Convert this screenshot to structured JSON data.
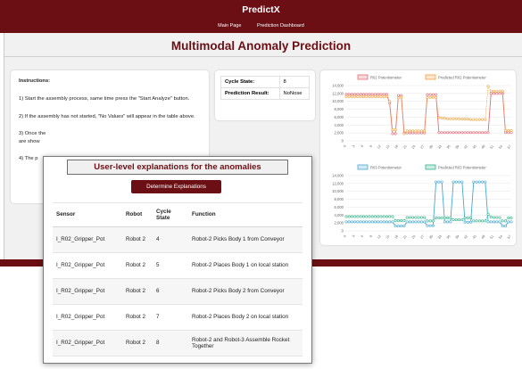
{
  "app": {
    "brand": "PredictX",
    "nav": [
      "Main Page",
      "Prediction Dashboard"
    ]
  },
  "page_title": "Multimodal Anomaly Prediction",
  "instructions": {
    "heading": "Instructions:",
    "items": [
      "1) Start the assembly process, same time press the \"Start Analyze\" button.",
      "2) If the assembly has not started, \"No Values\" will appear in the table above.",
      "3) Once the",
      "are show",
      "4) The p"
    ]
  },
  "state": {
    "cycle_label": "Cycle State:",
    "cycle_value": "8",
    "prediction_label": "Prediction Result:",
    "prediction_value": "NoNose"
  },
  "explanations": {
    "title": "User-level explanations for the anomalies",
    "button": "Determine Explanations",
    "headers": [
      "Sensor",
      "Robot",
      "Cycle State",
      "Function"
    ],
    "rows": [
      [
        "I_R02_Gripper_Pot",
        "Robot 2",
        "4",
        "Robot-2 Picks Body 1 from Conveyor"
      ],
      [
        "I_R02_Gripper_Pot",
        "Robot 2",
        "5",
        "Robot-2 Places Body 1 on local station"
      ],
      [
        "I_R02_Gripper_Pot",
        "Robot 2",
        "6",
        "Robot-2 Picks Body 2 from Conveyor"
      ],
      [
        "I_R02_Gripper_Pot",
        "Robot 2",
        "7",
        "Robot-2 Places Body 2 on local station"
      ],
      [
        "I_R02_Gripper_Pot",
        "Robot 2",
        "8",
        "Robot-2 and Robot-3 Assemble Rocket Together"
      ]
    ]
  },
  "colors": {
    "brand": "#6b0f14",
    "r02": "#e46b78",
    "r02_pred": "#f2a13a",
    "r03": "#46a8d6",
    "r03_pred": "#2fb38a"
  },
  "chart_data": [
    {
      "type": "line",
      "legend": [
        "R02 Potentiometer",
        "Predicted R02 Potentiometer"
      ],
      "legend_position": "top",
      "ylim": [
        0,
        14000
      ],
      "yticks": [
        "14,000",
        "12,000",
        "10,000",
        "8,000",
        "6,000",
        "4,000",
        "2,000",
        "0"
      ],
      "x": [
        0,
        1,
        2,
        3,
        4,
        5,
        6,
        7,
        8,
        9,
        10,
        11,
        12,
        13,
        14,
        15,
        16,
        17,
        18,
        19,
        20,
        21,
        22,
        23,
        24,
        25,
        26,
        27,
        28,
        29,
        30,
        31,
        32,
        33,
        34,
        35,
        36,
        37,
        38,
        39,
        40,
        41,
        42,
        43,
        44,
        45,
        46,
        47,
        48,
        49,
        50,
        51,
        52,
        53,
        54,
        55,
        56,
        57
      ],
      "xticks": [
        "0",
        "3",
        "6",
        "9",
        "12",
        "15",
        "18",
        "21",
        "24",
        "27",
        "30",
        "33",
        "36",
        "39",
        "42",
        "45",
        "48",
        "51",
        "54",
        "57"
      ],
      "series": [
        {
          "name": "R02 Potentiometer",
          "values": [
            11800,
            11800,
            11800,
            11800,
            11800,
            11800,
            11800,
            11800,
            11800,
            11800,
            11800,
            11800,
            11800,
            11800,
            11800,
            9500,
            1800,
            1800,
            11500,
            11500,
            2000,
            2000,
            2000,
            2000,
            2000,
            2000,
            2000,
            2000,
            11700,
            11700,
            11700,
            11700,
            2100,
            2100,
            2100,
            2100,
            2100,
            2100,
            2100,
            2100,
            2100,
            2100,
            2100,
            2100,
            2100,
            2100,
            2100,
            2100,
            2100,
            2100,
            12000,
            12000,
            12000,
            12000,
            12000,
            2100,
            2100,
            2100
          ]
        },
        {
          "name": "Predicted R02 Potentiometer",
          "values": [
            11200,
            11200,
            11200,
            11200,
            11200,
            11200,
            11200,
            11200,
            11200,
            11200,
            11200,
            11200,
            11200,
            11200,
            11200,
            10000,
            2800,
            2800,
            10900,
            11000,
            1800,
            2500,
            2500,
            2500,
            2500,
            2500,
            2500,
            2500,
            11000,
            11000,
            11000,
            11000,
            5900,
            5800,
            5700,
            5600,
            5600,
            5600,
            5600,
            5600,
            5500,
            5500,
            5500,
            5400,
            5400,
            5400,
            5400,
            5400,
            5400,
            13800,
            12600,
            12600,
            12600,
            12600,
            12600,
            2600,
            2600,
            2600
          ]
        }
      ]
    },
    {
      "type": "line",
      "legend": [
        "R03 Potentiometer",
        "Predicted R03 Potentiometer"
      ],
      "legend_position": "top",
      "ylim": [
        0,
        14000
      ],
      "yticks": [
        "14,000",
        "12,000",
        "10,000",
        "8,000",
        "6,000",
        "4,000",
        "2,000",
        "0"
      ],
      "x": [
        0,
        1,
        2,
        3,
        4,
        5,
        6,
        7,
        8,
        9,
        10,
        11,
        12,
        13,
        14,
        15,
        16,
        17,
        18,
        19,
        20,
        21,
        22,
        23,
        24,
        25,
        26,
        27,
        28,
        29,
        30,
        31,
        32,
        33,
        34,
        35,
        36,
        37,
        38,
        39,
        40,
        41,
        42,
        43,
        44,
        45,
        46,
        47,
        48,
        49,
        50,
        51,
        52,
        53,
        54,
        55,
        56,
        57
      ],
      "xticks": [
        "0",
        "3",
        "6",
        "9",
        "12",
        "15",
        "18",
        "21",
        "24",
        "27",
        "30",
        "33",
        "36",
        "39",
        "42",
        "45",
        "48",
        "51",
        "54",
        "57"
      ],
      "series": [
        {
          "name": "R03 Potentiometer",
          "values": [
            2300,
            2300,
            2300,
            2300,
            2300,
            2300,
            2300,
            2300,
            2300,
            2300,
            2300,
            2300,
            2300,
            2300,
            2300,
            2300,
            2300,
            1200,
            1200,
            1200,
            1200,
            2300,
            2300,
            2300,
            2300,
            2300,
            2300,
            2300,
            1300,
            1300,
            1300,
            12400,
            12400,
            12400,
            2300,
            2300,
            2300,
            12400,
            12400,
            12400,
            12400,
            2200,
            2200,
            2200,
            12400,
            12400,
            12400,
            12400,
            12400,
            2300,
            2300,
            2300,
            2300,
            2300,
            1200,
            1200,
            2300,
            2300
          ]
        },
        {
          "name": "Predicted R03 Potentiometer",
          "values": [
            3600,
            3600,
            3600,
            3600,
            3600,
            3600,
            3600,
            3600,
            3600,
            3600,
            3600,
            3600,
            3600,
            3600,
            3600,
            3600,
            3600,
            2600,
            2600,
            2600,
            2600,
            3400,
            3400,
            3400,
            3400,
            3400,
            3400,
            3400,
            2500,
            2500,
            2500,
            3300,
            3300,
            3300,
            3300,
            3300,
            3300,
            2800,
            2800,
            2800,
            2800,
            3300,
            3300,
            3300,
            2500,
            2500,
            2500,
            2500,
            2500,
            4200,
            3500,
            3400,
            3400,
            3400,
            2500,
            2500,
            3300,
            3300
          ]
        }
      ]
    }
  ]
}
